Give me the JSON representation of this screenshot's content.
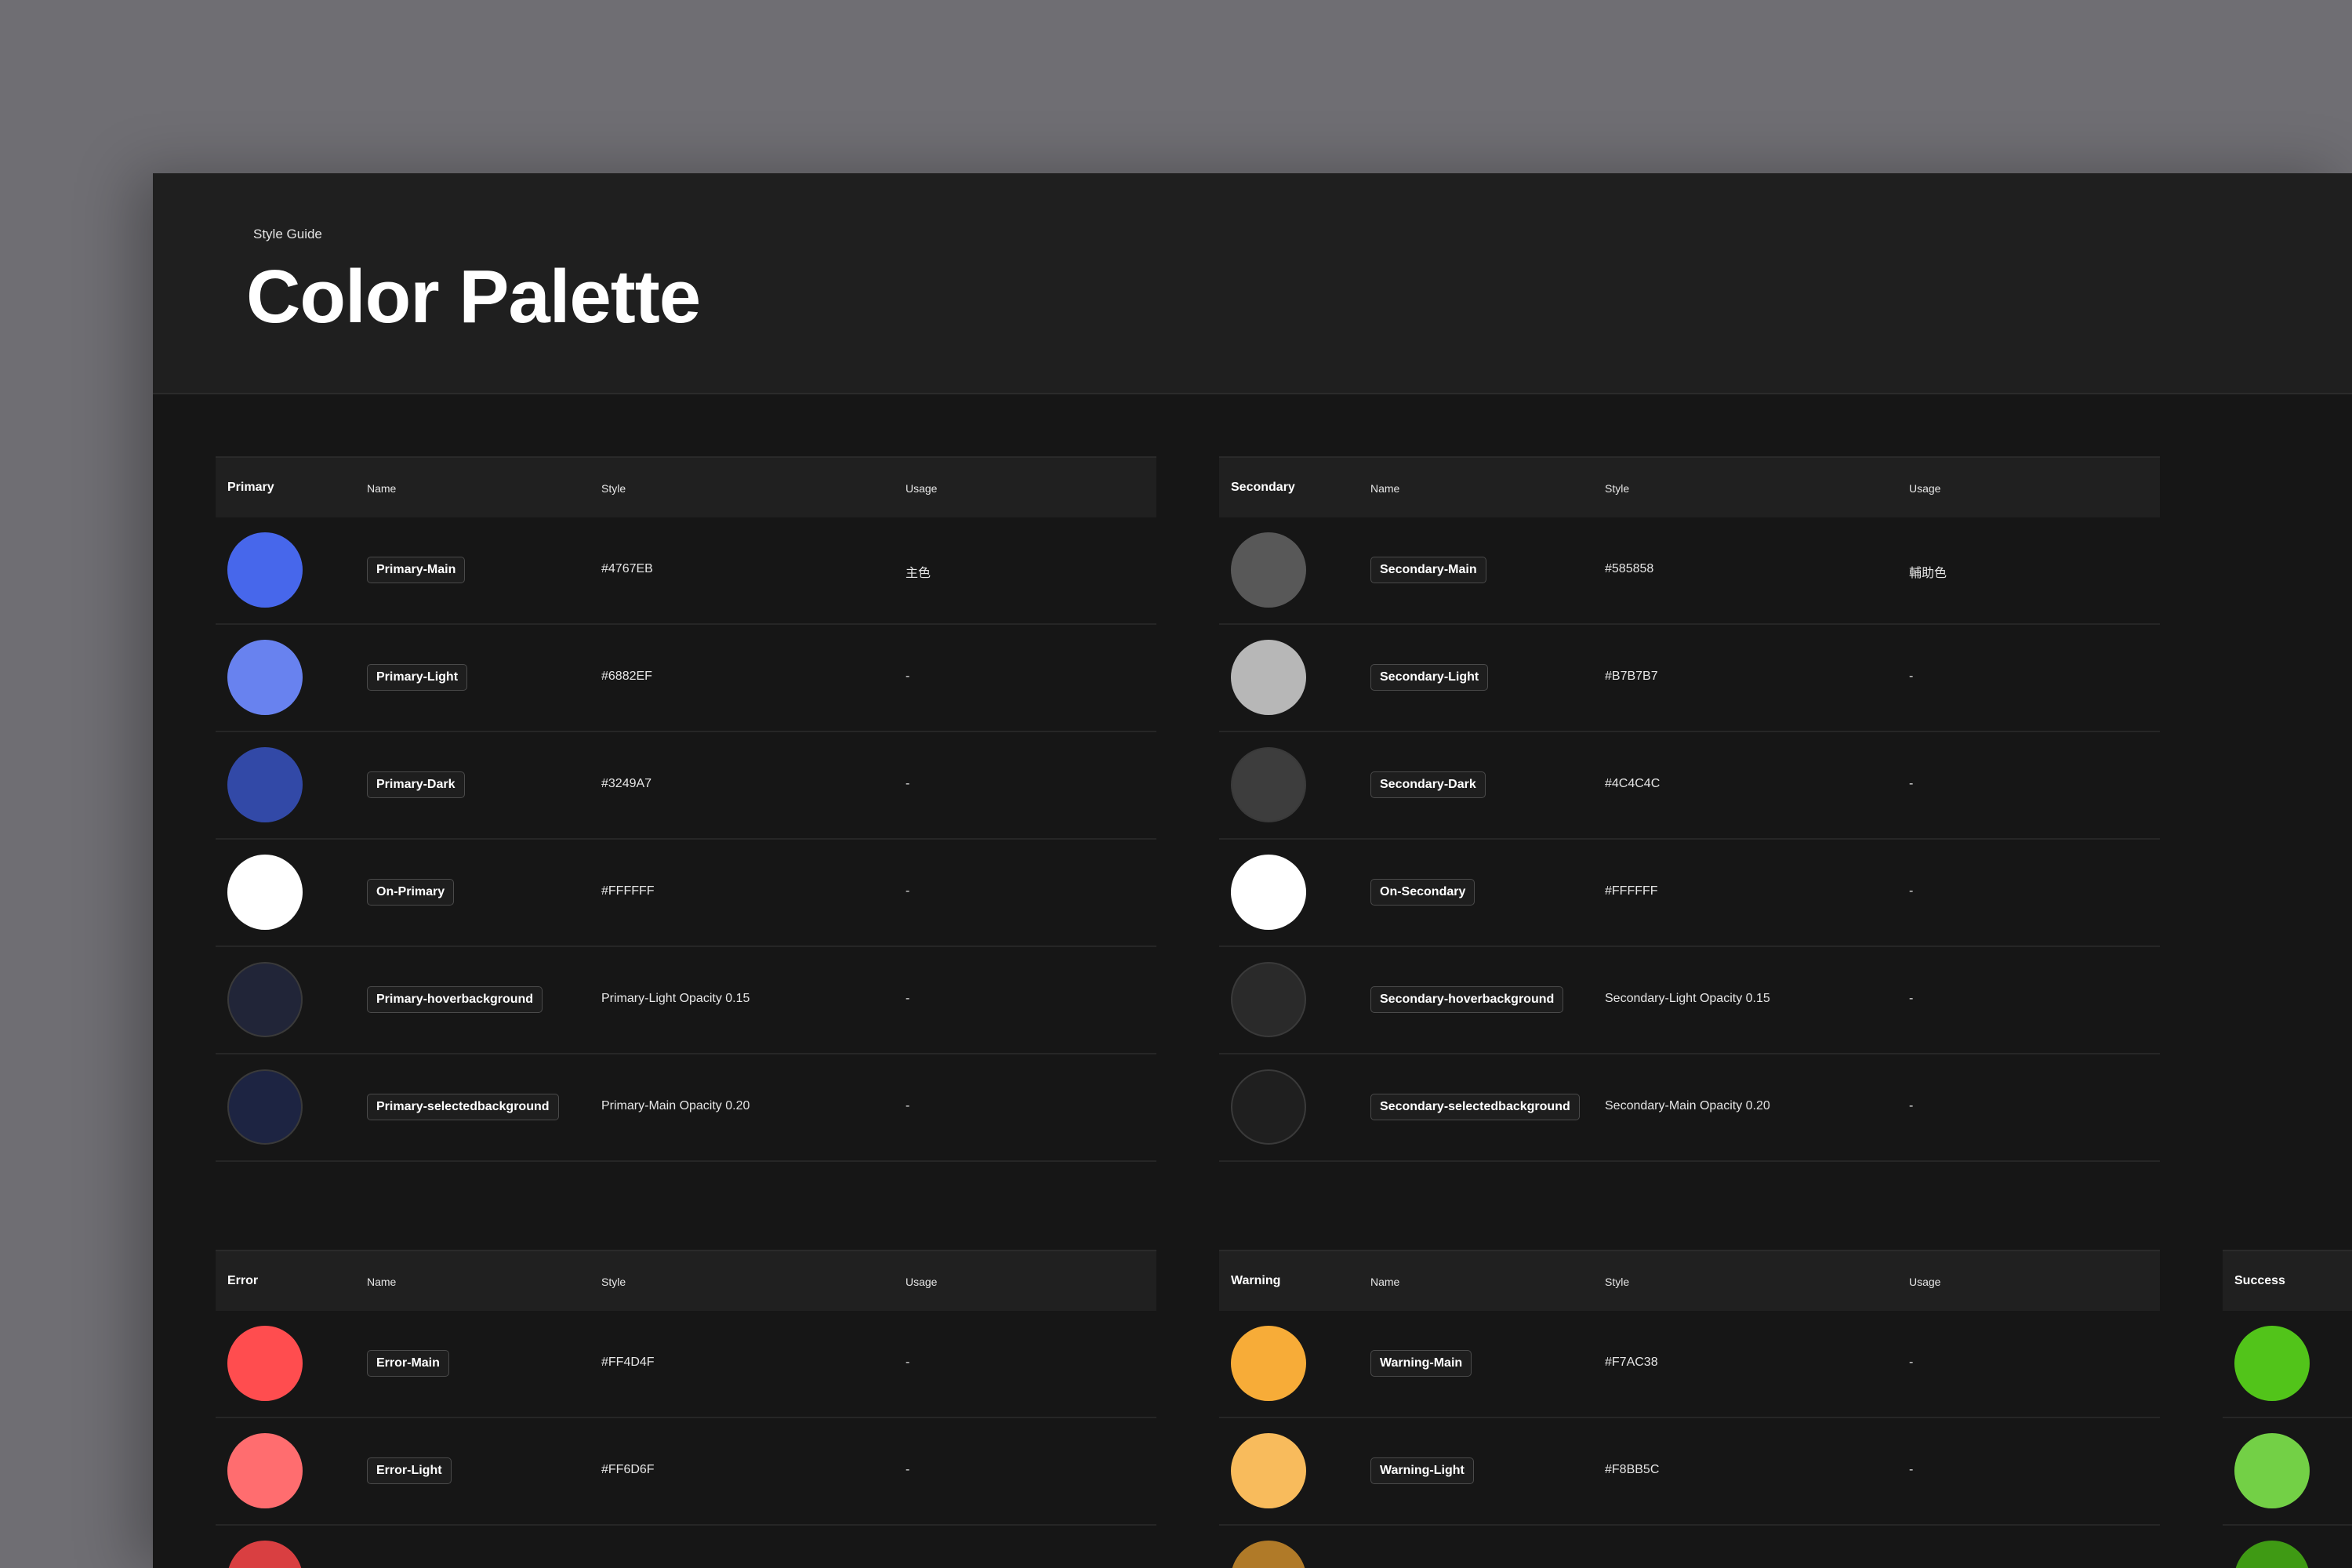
{
  "header": {
    "eyebrow": "Style Guide",
    "title": "Color Palette"
  },
  "columns": {
    "name": "Name",
    "style": "Style",
    "usage": "Usage"
  },
  "groups": {
    "primary": {
      "title": "Primary",
      "rows": [
        {
          "name": "Primary-Main",
          "style": "#4767EB",
          "usage": "主色",
          "swatch": "#4767EB"
        },
        {
          "name": "Primary-Light",
          "style": "#6882EF",
          "usage": "-",
          "swatch": "#6882EF"
        },
        {
          "name": "Primary-Dark",
          "style": "#3249A7",
          "usage": "-",
          "swatch": "#3249A7"
        },
        {
          "name": "On-Primary",
          "style": "#FFFFFF",
          "usage": "-",
          "swatch": "#FFFFFF"
        },
        {
          "name": "Primary-hoverbackground",
          "style": "Primary-Light Opacity 0.15",
          "usage": "-",
          "swatch": "#212538"
        },
        {
          "name": "Primary-selectedbackground",
          "style": "Primary-Main Opacity 0.20",
          "usage": "-",
          "swatch": "#1d2442"
        }
      ]
    },
    "secondary": {
      "title": "Secondary",
      "rows": [
        {
          "name": "Secondary-Main",
          "style": "#585858",
          "usage": "輔助色",
          "swatch": "#585858"
        },
        {
          "name": "Secondary-Light",
          "style": "#B7B7B7",
          "usage": "-",
          "swatch": "#B7B7B7"
        },
        {
          "name": "Secondary-Dark",
          "style": "#4C4C4C",
          "usage": "-",
          "swatch": "#3d3d3d"
        },
        {
          "name": "On-Secondary",
          "style": "#FFFFFF",
          "usage": "-",
          "swatch": "#FFFFFF"
        },
        {
          "name": "Secondary-hoverbackground",
          "style": "Secondary-Light Opacity 0.15",
          "usage": "-",
          "swatch": "#2a2a2a"
        },
        {
          "name": "Secondary-selectedbackground",
          "style": "Secondary-Main Opacity 0.20",
          "usage": "-",
          "swatch": "#1f1f1f"
        }
      ]
    },
    "error": {
      "title": "Error",
      "rows": [
        {
          "name": "Error-Main",
          "style": "#FF4D4F",
          "usage": "-",
          "swatch": "#FF4D4F"
        },
        {
          "name": "Error-Light",
          "style": "#FF6D6F",
          "usage": "-",
          "swatch": "#FF6D6F"
        },
        {
          "name": "",
          "style": "",
          "usage": "",
          "swatch": "#d93f41"
        }
      ]
    },
    "warning": {
      "title": "Warning",
      "rows": [
        {
          "name": "Warning-Main",
          "style": "#F7AC38",
          "usage": "-",
          "swatch": "#F7AC38"
        },
        {
          "name": "Warning-Light",
          "style": "#F8BB5C",
          "usage": "-",
          "swatch": "#F8BB5C"
        },
        {
          "name": "",
          "style": "",
          "usage": "",
          "swatch": "#b07a28"
        }
      ]
    },
    "success": {
      "title": "Success",
      "rows": [
        {
          "swatch": "#52C41A"
        },
        {
          "swatch": "#73d046"
        },
        {
          "swatch": "#3f9a14"
        }
      ]
    }
  }
}
